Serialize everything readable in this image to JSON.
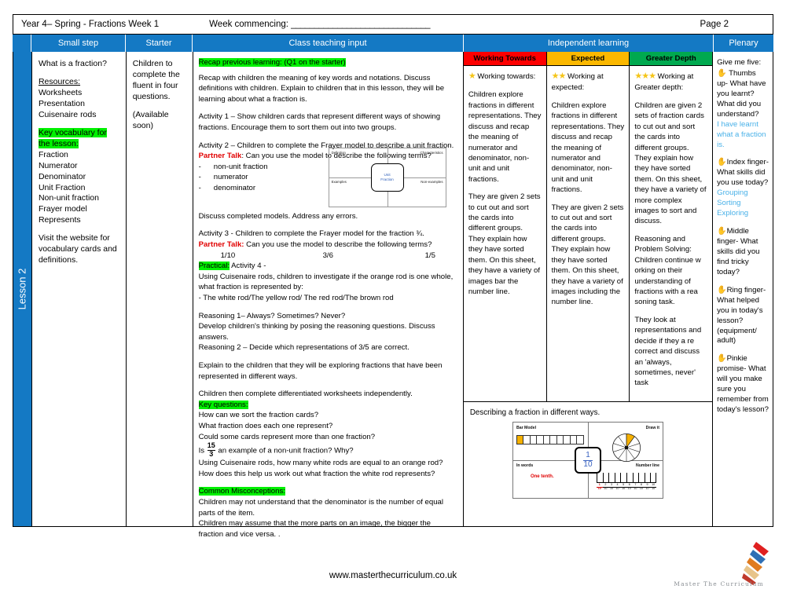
{
  "header": {
    "title": "Year 4– Spring - Fractions Week 1",
    "week_commencing_label": "Week commencing: ",
    "week_commencing_value": "______________________________",
    "page_number": "Page 2"
  },
  "band": {
    "small_step": "Small step",
    "starter": "Starter",
    "class_teaching_input": "Class teaching input",
    "independent_learning": "Independent learning",
    "plenary": "Plenary"
  },
  "spine": {
    "label": "Lesson 2"
  },
  "small_step": {
    "question": "What is a fraction?",
    "resources_heading": "Resources:",
    "resources": [
      "Worksheets",
      "Presentation",
      "Cuisenaire rods"
    ],
    "vocab_heading": "Key vocabulary for the lesson:",
    "vocab": [
      "Fraction",
      "Numerator",
      "Denominator",
      "Unit Fraction",
      "Non-unit fraction",
      "Frayer model",
      "Represents"
    ],
    "footnote": "Visit the website for vocabulary cards and definitions."
  },
  "starter": {
    "body": "Children to complete the fluent in four questions.",
    "availability": "(Available soon)"
  },
  "class_input": {
    "recap_heading": "Recap previous learning: (Q1 on the starter)",
    "recap_body": "Recap with children the meaning of key words and notations. Discuss definitions with children. Explain to children that in this lesson, they will be learning about what a fraction is.",
    "activity1": "Activity 1 – Show children cards that represent different ways of showing fractions. Encourage them to sort them out into two groups.",
    "activity2": "Activity 2 – Children to complete the Frayer model to describe a unit fraction.",
    "partner_talk_label": "Partner Talk",
    "partner_talk_1": ": Can you use the model to describe the following terms?",
    "partner_terms": [
      "non-unit fraction",
      "numerator",
      "denominator"
    ],
    "frayer": {
      "definition": "Definition",
      "characteristics": "Characteristics",
      "examples": "Examples",
      "non_examples": "Non-examples",
      "center_line1": "Unit",
      "center_line2": "Fraction"
    },
    "discuss_models": "Discuss completed models. Address any errors.",
    "activity3": "Activity 3 - Children to complete the Frayer model for the fraction ¾.",
    "partner_talk_label2": "Partner Talk:",
    "partner_talk_2": " Can you use the model to describe the following terms?",
    "fraction_examples": [
      "1/10",
      "3/6",
      "1/5"
    ],
    "practical_label": "Practical:",
    "activity4": " Activity 4 -",
    "cuisenaire_body": "Using Cuisenaire rods,  children to investigate if the orange rod is one whole, what fraction is represented by:",
    "rods_line": "-            The white rod/The yellow rod/ The red rod/The brown rod",
    "reasoning1": "Reasoning 1– Always? Sometimes? Never?",
    "reasoning1_body": "Develop children's thinking by posing the reasoning questions. Discuss answers.",
    "reasoning2": "Reasoning 2 – Decide which representations of 3/5 are correct.",
    "explain_body": "Explain to the children that they will be exploring fractions that have been represented in different ways.",
    "worksheets_line": "Children then complete differentiated worksheets independently.",
    "key_questions_heading": "Key questions:",
    "key_questions": [
      "How can we sort the fraction cards?",
      "What fraction does each one represent?",
      "Could some cards represent more than one fraction?"
    ],
    "kq_fraction_pre": "Is",
    "kq_fraction_num": "15",
    "kq_fraction_den": "3",
    "kq_fraction_post": "an example of a non-unit fraction? Why?",
    "kq_last": "Using Cuisenaire rods, how many white rods are equal to an orange rod? How does this help us work out what fraction the white rod represents?",
    "misconceptions_heading": "Common Misconceptions:",
    "misconceptions": [
      "Children may not understand that the denominator is the number of equal parts of the item.",
      "Children may assume that the more parts on an image, the bigger the fraction and vice versa. ."
    ]
  },
  "independent": {
    "columns": [
      {
        "header": "Working Towards",
        "header_color": "#fd0000",
        "stars": "★",
        "level_label": "Working towards:",
        "paragraphs": [
          "Children explore fractions in different representations. They discuss and recap the meaning of numerator and denominator, non-unit and unit fractions.",
          "They are given 2 sets to cut out and sort the cards into different groups. They explain how they have sorted them. On this sheet, they have a variety of images bar the number line."
        ]
      },
      {
        "header": "Expected",
        "header_color": "#fbb800",
        "stars": "★★",
        "level_label": "Working at expected:",
        "paragraphs": [
          "Children explore fractions in different representations. They discuss and recap the meaning of numerator and denominator, non-unit and unit fractions.",
          "They are given 2 sets to cut out and sort the cards into different groups. They explain how they have sorted them. On this sheet, they have a variety of images including the number line."
        ]
      },
      {
        "header": "Greater Depth",
        "header_color": "#00a94f",
        "stars": "★★★",
        "level_label": "Working at Greater depth:",
        "paragraphs": [
          "Children are given 2 sets of fraction cards to cut out and sort the cards into different groups. They explain how they have sorted them. On this sheet, they have a variety of more complex images to sort and discuss.",
          "Reasoning and Problem Solving: Children continue w orking on their understanding of fractions with a rea soning task.",
          "They look at representations and decide if they a re correct and  discuss an 'always, sometimes, never' task"
        ]
      }
    ],
    "bottom_caption": "Describing a fraction in different ways.",
    "worksheet": {
      "bar_model_label": "Bar Model",
      "draw_it_label": "Draw it",
      "in_words_label": "In words",
      "number_line_label": "Number line",
      "in_words_value": "One tenth.",
      "center_num": "1",
      "center_den": "10",
      "bar_segments": 10,
      "bar_filled": 1,
      "pie_segments": 10,
      "pie_filled": 1,
      "number_line_labels": [
        {
          "n": "1",
          "d": "10"
        },
        {
          "n": "2",
          "d": "10"
        },
        {
          "n": "3",
          "d": "10"
        },
        {
          "n": "4",
          "d": "10"
        },
        {
          "n": "5",
          "d": "10"
        },
        {
          "n": "6",
          "d": "10"
        },
        {
          "n": "7",
          "d": "10"
        },
        {
          "n": "8",
          "d": "10"
        },
        {
          "n": "9",
          "d": "10"
        },
        {
          "n": "10",
          "d": "10"
        }
      ]
    }
  },
  "plenary": {
    "heading": "Give me five:",
    "items": [
      {
        "icon": "hand-icon",
        "question": "Thumbs up- What have you learnt? What did you understand?",
        "answers": [
          "I have learnt what a fraction is."
        ]
      },
      {
        "icon": "hand-icon",
        "question": "Index finger- What skills did you use today?",
        "answers": [
          "Grouping",
          "Sorting",
          "Exploring"
        ]
      },
      {
        "icon": "hand-icon",
        "question": "Middle finger- What skills did you find tricky today?",
        "answers": []
      },
      {
        "icon": "hand-icon",
        "question": "Ring finger- What helped you in today's lesson? (equipment/ adult)",
        "answers": []
      },
      {
        "icon": "hand-icon",
        "question": "Pinkie promise- What will you make sure you remember from today's lesson?",
        "answers": []
      }
    ]
  },
  "footer": {
    "url": "www.masterthecurriculum.co.uk",
    "logo_text": "Master The Curriculum"
  },
  "colors": {
    "brand_blue": "#1479c4",
    "highlight_green": "#00f000",
    "red": "#fd0000",
    "amber": "#fbb800",
    "green": "#00a94f",
    "answer_blue": "#49b1e8"
  }
}
